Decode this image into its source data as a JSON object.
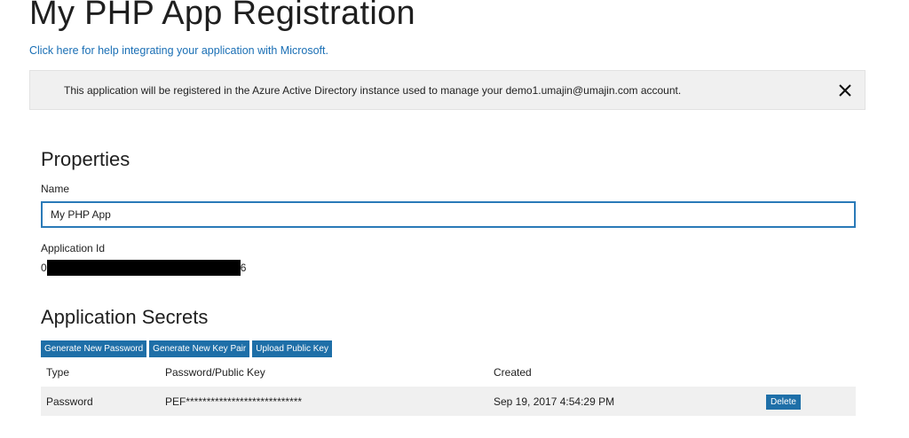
{
  "page": {
    "title": "My PHP App Registration",
    "help_link": "Click here for help integrating your application with Microsoft."
  },
  "notice": {
    "text": "This application will be registered in the Azure Active Directory instance used to manage your demo1.umajin@umajin.com account.",
    "close_icon": "close-x-icon"
  },
  "properties": {
    "heading": "Properties",
    "name_label": "Name",
    "name_value": "My PHP App",
    "app_id_label": "Application Id",
    "app_id_prefix": "0",
    "app_id_suffix": "6"
  },
  "secrets": {
    "heading": "Application Secrets",
    "buttons": {
      "generate_password": "Generate New Password",
      "generate_key_pair": "Generate New Key Pair",
      "upload_public_key": "Upload Public Key"
    },
    "columns": [
      "Type",
      "Password/Public Key",
      "Created"
    ],
    "rows": [
      {
        "type": "Password",
        "key": "PEF****************************",
        "created": "Sep 19, 2017 4:54:29 PM",
        "action": "Delete"
      }
    ]
  },
  "colors": {
    "accent": "#1e6fa8",
    "link": "#1a6fb5",
    "notice_bg": "#f0f0f0",
    "input_border": "#2a7ab8"
  }
}
